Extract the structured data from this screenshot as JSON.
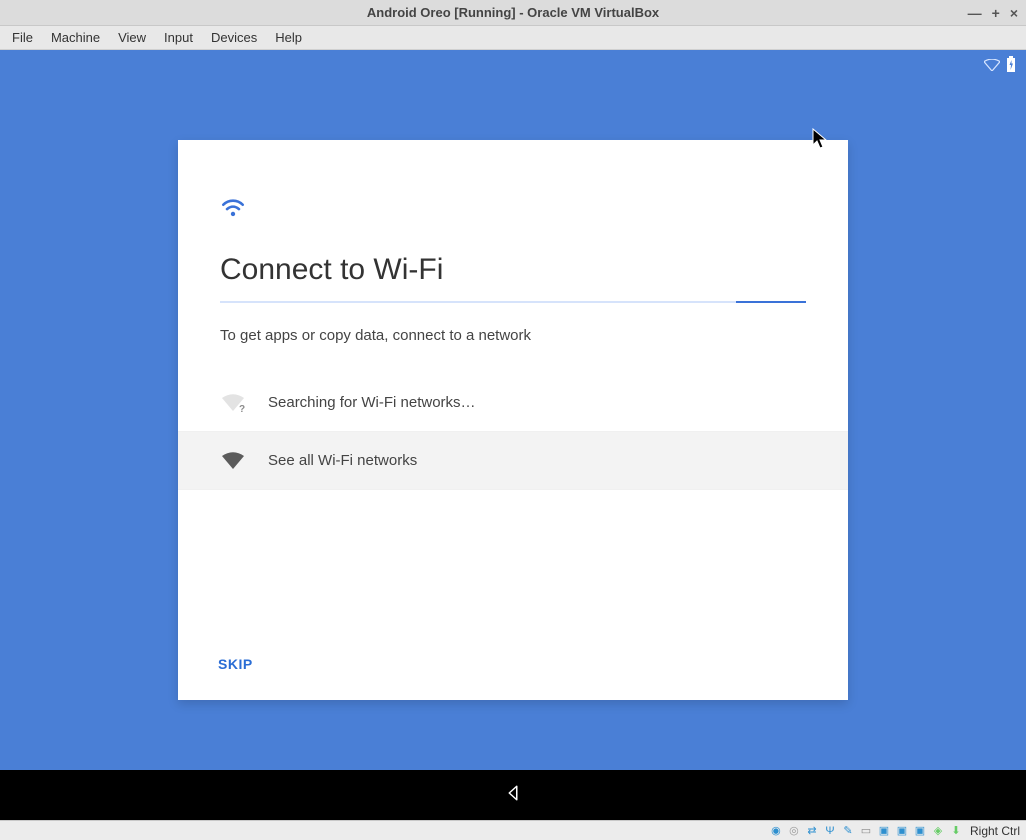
{
  "window": {
    "title": "Android Oreo [Running] - Oracle VM VirtualBox"
  },
  "menubar": {
    "items": [
      "File",
      "Machine",
      "View",
      "Input",
      "Devices",
      "Help"
    ]
  },
  "setup": {
    "heading": "Connect to Wi-Fi",
    "subtitle": "To get apps or copy data, connect to a network",
    "searching_label": "Searching for Wi-Fi networks…",
    "see_all_label": "See all Wi-Fi networks",
    "skip_label": "SKIP"
  },
  "statusbar": {
    "host_key": "Right Ctrl"
  }
}
